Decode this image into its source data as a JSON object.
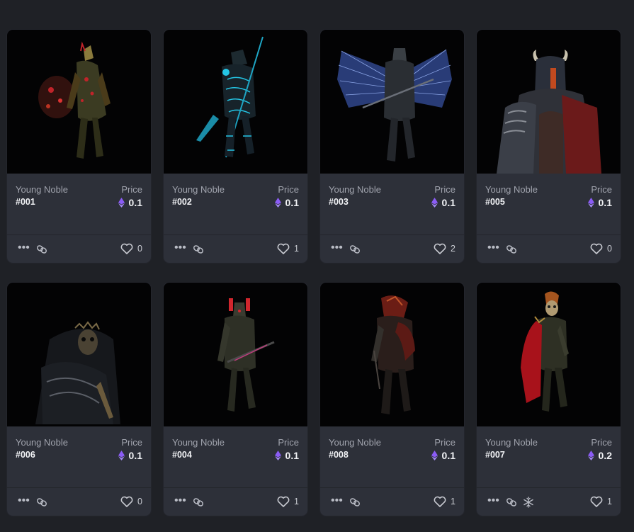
{
  "cards": [
    {
      "collection": "Young Noble",
      "token": "#001",
      "price_label": "Price",
      "price": "0.1",
      "likes": "0",
      "accent": "#c0242a",
      "art": "red-armor-knight"
    },
    {
      "collection": "Young Noble",
      "token": "#002",
      "price_label": "Price",
      "price": "0.1",
      "likes": "1",
      "accent": "#24c6e6",
      "art": "cyan-glow-knight"
    },
    {
      "collection": "Young Noble",
      "token": "#003",
      "price_label": "Price",
      "price": "0.1",
      "likes": "2",
      "accent": "#5d7fd8",
      "art": "winged-knight"
    },
    {
      "collection": "Young Noble",
      "token": "#005",
      "price_label": "Price",
      "price": "0.1",
      "likes": "0",
      "accent": "#b8241d",
      "art": "horned-helm-knight"
    },
    {
      "collection": "Young Noble",
      "token": "#006",
      "price_label": "Price",
      "price": "0.1",
      "likes": "0",
      "accent": "#7a6a47",
      "art": "crowned-skeleton"
    },
    {
      "collection": "Young Noble",
      "token": "#004",
      "price_label": "Price",
      "price": "0.1",
      "likes": "1",
      "accent": "#d1262d",
      "art": "crossbow-knight"
    },
    {
      "collection": "Young Noble",
      "token": "#008",
      "price_label": "Price",
      "price": "0.1",
      "likes": "1",
      "accent": "#9c2a22",
      "art": "red-beast-knight"
    },
    {
      "collection": "Young Noble",
      "token": "#007",
      "price_label": "Price",
      "price": "0.2",
      "likes": "1",
      "accent": "#a8121b",
      "art": "skeleton-red-cape"
    }
  ],
  "colors": {
    "background": "#1f2126",
    "card": "#2d3039",
    "eth": "#8b5cf6"
  },
  "icons": {
    "more": "more-dots-icon",
    "link": "link-icon",
    "freeze": "snowflake-icon",
    "like": "heart-icon",
    "currency": "ethereum-icon"
  }
}
